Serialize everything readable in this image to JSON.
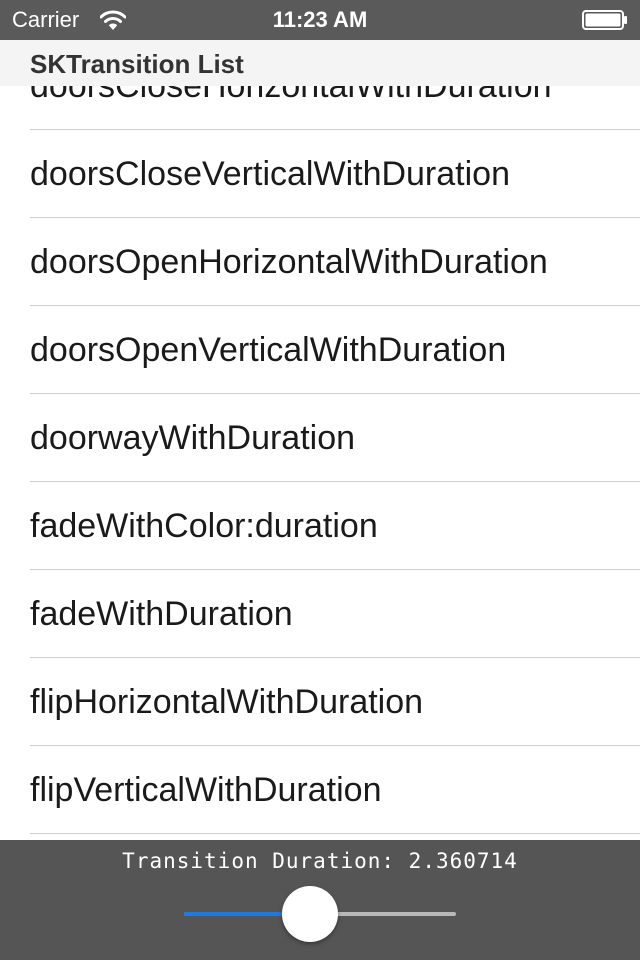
{
  "status_bar": {
    "carrier": "Carrier",
    "time": "11:23 AM",
    "wifi_icon": "wifi-icon",
    "battery_icon": "battery-full-icon"
  },
  "nav": {
    "title": "SKTransition List"
  },
  "list": {
    "items": [
      "doorsCloseHorizontalWithDuration",
      "doorsCloseVerticalWithDuration",
      "doorsOpenHorizontalWithDuration",
      "doorsOpenVerticalWithDuration",
      "doorwayWithDuration",
      "fadeWithColor:duration",
      "fadeWithDuration",
      "flipHorizontalWithDuration",
      "flipVerticalWithDuration"
    ]
  },
  "duration_panel": {
    "label": "Transition Duration: 2.360714",
    "slider_fraction": 0.456
  },
  "colors": {
    "status_bar_bg": "#5a5a5a",
    "title_bar_bg": "#f4f4f4",
    "panel_bg": "#555555",
    "slider_accent": "#1f7ae0",
    "slider_track": "#b8b8b8"
  }
}
